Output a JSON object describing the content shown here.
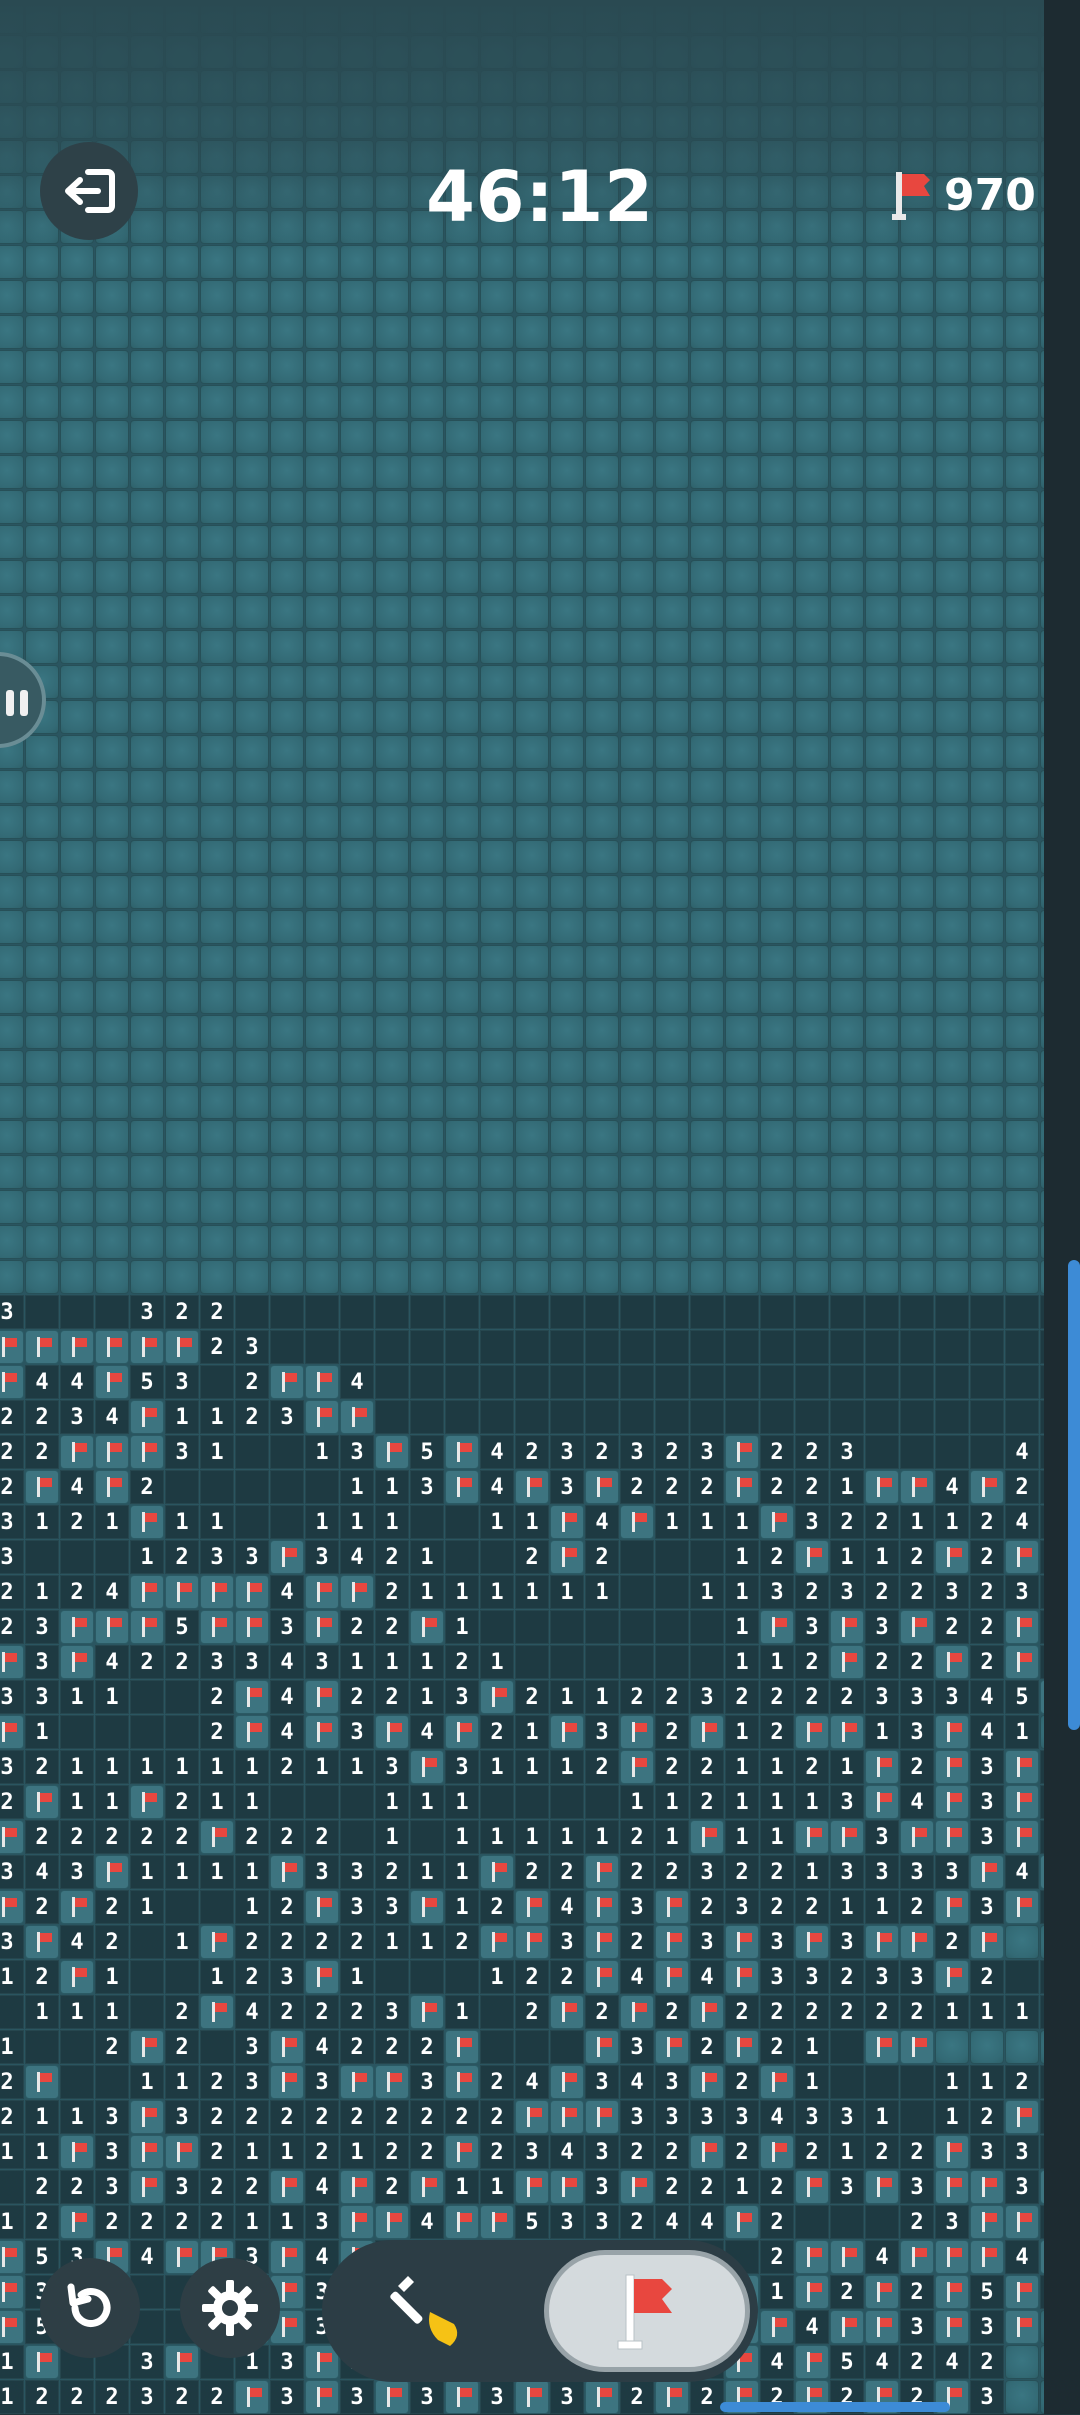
{
  "header": {
    "timer": "46:12",
    "flags_remaining": "970"
  },
  "board": {
    "revealed_rows": [
      "3...322...........................",
      "FFFFFF23..........................FF",
      "F44F53.2FF4....................F4F3",
      "2234F1123FF...................311",
      "22FFF31..13F5F4232323F223....4..21",
      "2F4F2.....113F4F3F222F221FF4F21",
      "3121F11..111..11F4F111F3221124231",
      "3...1233F3421..2F2...12F112F2F21",
      "2124FFFF4FF2111111..1132322323111",
      "23FFF5FF3F22F1.......1F3F3F22F4221",
      "F3F422334311121......112F22F2F4F23F",
      "3311..2F4F2213F211223222233345F41",
      "F1....2F4F3F4F21F3F2F12FF13F41",
      "321111112113F31112F221121F2F3F3F",
      "2F11F211...111....1121113F4F3F31",
      "F22222F222.1.1111121F11FF3FF3F2",
      "343F1111F33211F22F2232213333F4F",
      "F2F21..12F33F12F4F3F2322112F3F4",
      "3F42.1F2222112FF3F2F3F3F3FF2F",
      "12F1..123F1...122F4F4F33233F2..11",
      ".111.2F42223F1.2F2F2F222222111111",
      "1..2F2.3F4222F...F3F2F21.FF",
      "2F..1123F3FF3F24F343F2F1...11222F",
      "2113F3222222222FFF33334331.12F111",
      "11F3FF2112122F234322F2F2122F33332",
      ".223F322F4F2F11FF3F2212F3F3FF3F",
      "12F2222113FF4FF533244F2...23FF42",
      "F53F4FF3F4F23F34F42F..2FF4FFF4F3",
      "F3.F..F.F3F2F1F4FF3F2F1F2F2F5F4F3",
      "F5F5..FFF3F5F.F3.F2F4FF4FF3F3F",
      "1F..3F.13F2F.F3F.F2F2F4F54242",
      "1222322F3F3F3F3F3F2F2F2F2F2F3"
    ]
  },
  "controls": {
    "mode_selected": "flag"
  },
  "colors": {
    "accent": "#3d8bd6",
    "flag": "#e8473f"
  }
}
